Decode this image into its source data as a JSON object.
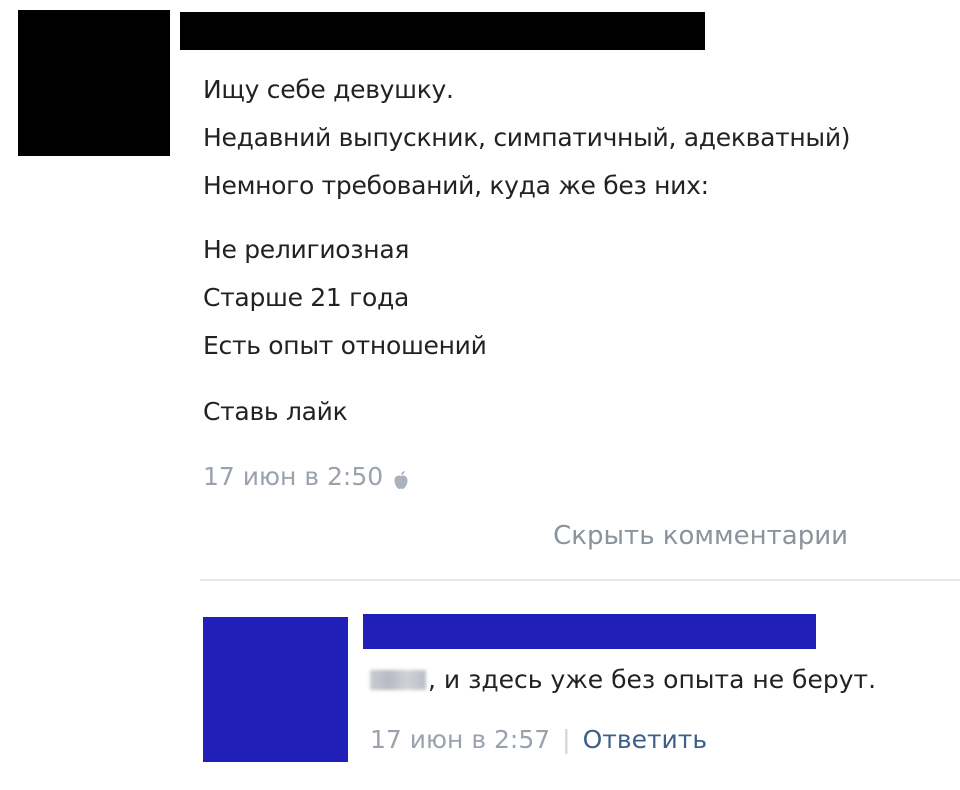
{
  "post": {
    "lines": [
      "Ищу себе девушку.",
      "Недавний выпускник, симпатичный, адекватный)",
      "Немного требований, куда же без них:"
    ],
    "requirements": [
      "Не религиозная",
      "Старше 21 года",
      "Есть опыт отношений"
    ],
    "call_to_action": "Ставь лайк",
    "timestamp": "17 июн в 2:50",
    "device_icon": "apple-icon",
    "hide_comments_label": "Скрыть комментарии"
  },
  "comment": {
    "text": ", и здесь уже без опыта не берут.",
    "timestamp": "17 июн в 2:57",
    "divider": "|",
    "reply_label": "Ответить"
  },
  "colors": {
    "redaction_black": "#000000",
    "redaction_blue": "#2020b8",
    "meta_gray": "#9aa3ad",
    "link_blue": "#3e5f8a"
  }
}
